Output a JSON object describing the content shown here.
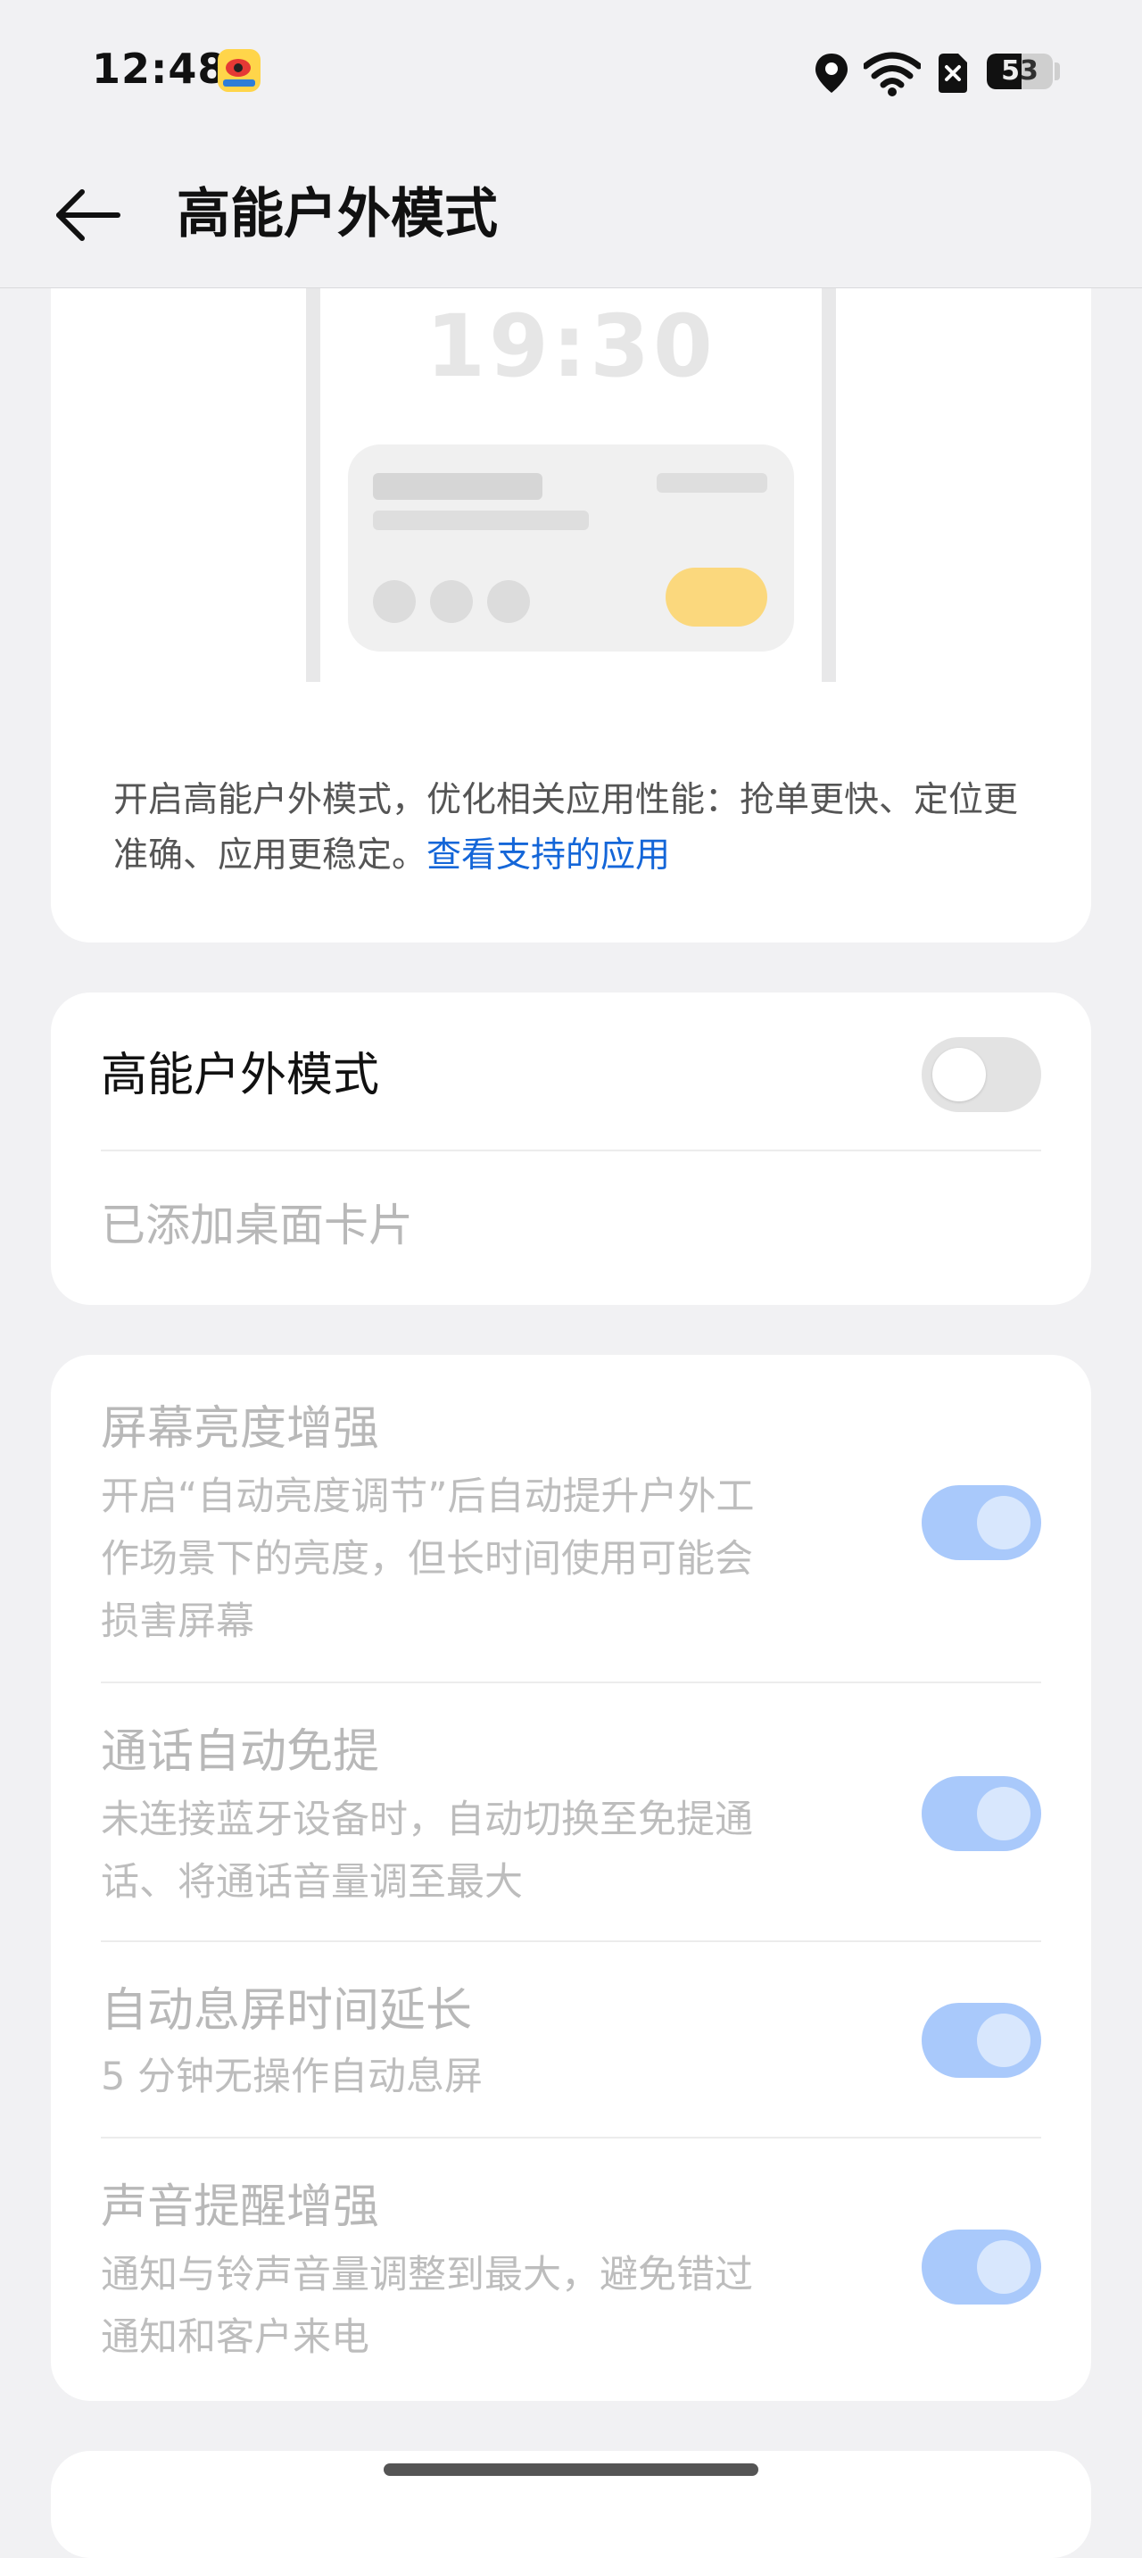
{
  "status_bar": {
    "time": "12:48",
    "app_icon": "weibo-icon",
    "icons": [
      "location-icon",
      "wifi-icon",
      "no-sim-icon",
      "battery-icon"
    ],
    "battery_level": "53",
    "battery_fraction": 0.53
  },
  "header": {
    "back_icon": "back-arrow-icon",
    "title": "高能户外模式"
  },
  "intro_card": {
    "illustration_clock": "19:30",
    "description": "开启高能户外模式，优化相关应用性能：抢单更快、定位更准确、应用更稳定。",
    "link_text": "查看支持的应用",
    "colors": {
      "link": "#1466d8",
      "pill": "#fbd87d"
    }
  },
  "mode_card": {
    "title": "高能户外模式",
    "toggle_on": false,
    "secondary_item": "已添加桌面卡片"
  },
  "settings": [
    {
      "title": "屏幕亮度增强",
      "subtitle_lines": [
        "开启“自动亮度调节”后自动提升户外工",
        "作场景下的亮度，但长时间使用可能会",
        "损害屏幕"
      ],
      "toggle_on": true,
      "enabled": false
    },
    {
      "title": "通话自动免提",
      "subtitle_lines": [
        "未连接蓝牙设备时，自动切换至免提通",
        "话、将通话音量调至最大"
      ],
      "toggle_on": true,
      "enabled": false
    },
    {
      "title": "自动息屏时间延长",
      "subtitle_lines": [
        "5 分钟无操作自动息屏"
      ],
      "toggle_on": true,
      "enabled": false
    },
    {
      "title": "声音提醒增强",
      "subtitle_lines": [
        "通知与铃声音量调整到最大，避免错过",
        "通知和客户来电"
      ],
      "toggle_on": true,
      "enabled": false
    }
  ],
  "theme": {
    "background": "#f1f1f3",
    "toggle_on_disabled": "#a9c9fb",
    "toggle_off": "#e3e3e3"
  }
}
